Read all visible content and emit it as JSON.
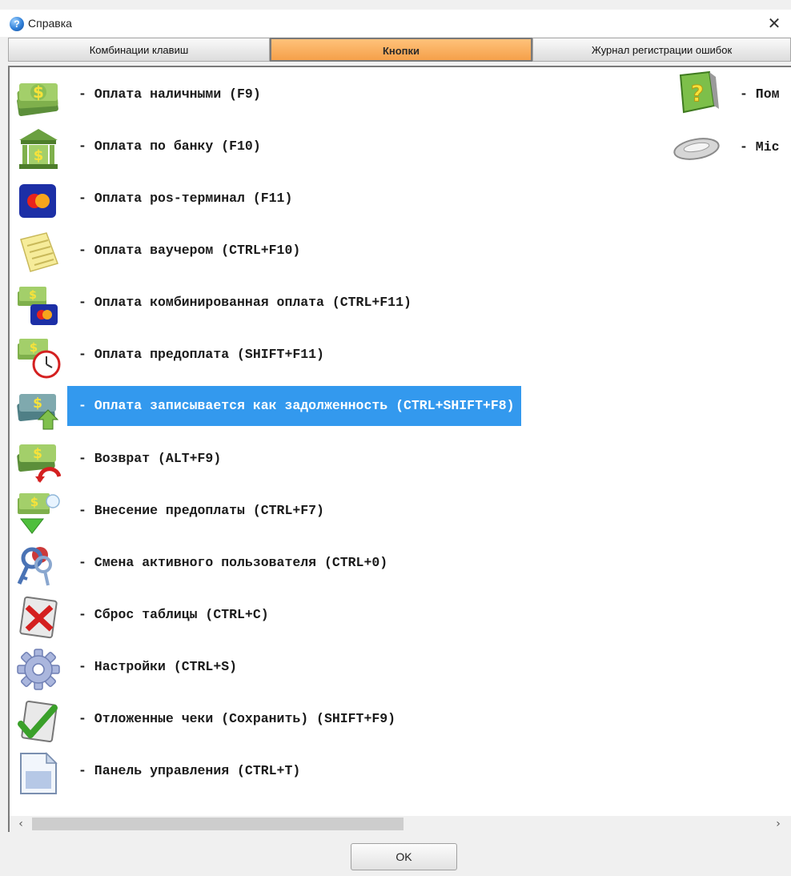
{
  "window": {
    "title": "Справка",
    "close_glyph": "✕"
  },
  "tabs": [
    {
      "label": "Комбинации клавиш",
      "active": false
    },
    {
      "label": "Кнопки",
      "active": true
    },
    {
      "label": "Журнал регистрации ошибок",
      "active": false
    }
  ],
  "items": [
    {
      "icon": "cash-money-icon",
      "label": "- Оплата наличными (F9)"
    },
    {
      "icon": "bank-building-icon",
      "label": "- Оплата по банку (F10)"
    },
    {
      "icon": "credit-card-icon",
      "label": "- Оплата pos-терминал (F11)"
    },
    {
      "icon": "voucher-notepad-icon",
      "label": "- Оплата ваучером (CTRL+F10)"
    },
    {
      "icon": "combined-payment-icon",
      "label": "- Оплата комбинированная оплата (CTRL+F11)"
    },
    {
      "icon": "prepayment-clock-icon",
      "label": "- Оплата предоплата (SHIFT+F11)"
    },
    {
      "icon": "debt-money-icon",
      "label": "- Оплата записывается как задолженность (CTRL+SHIFT+F8)",
      "selected": true
    },
    {
      "icon": "refund-money-icon",
      "label": "- Возврат (ALT+F9)"
    },
    {
      "icon": "deposit-prepayment-icon",
      "label": "- Внесение предоплаты (CTRL+F7)"
    },
    {
      "icon": "user-keys-icon",
      "label": "- Смена активного пользователя (CTRL+0)"
    },
    {
      "icon": "reset-table-icon",
      "label": "- Сброс таблицы (CTRL+C)"
    },
    {
      "icon": "settings-gear-icon",
      "label": "- Настройки (CTRL+S)"
    },
    {
      "icon": "deferred-receipt-icon",
      "label": "- Отложенные чеки (Сохранить) (SHIFT+F9)"
    },
    {
      "icon": "control-panel-icon",
      "label": "- Панель управления (CTRL+T)"
    }
  ],
  "items_col2": [
    {
      "icon": "help-book-icon",
      "label": "- Пом"
    },
    {
      "icon": "scanner-device-icon",
      "label": "- Mic"
    }
  ],
  "footer": {
    "ok_label": "OK"
  },
  "scrollbar": {
    "left_glyph": "‹",
    "right_glyph": "›"
  },
  "colors": {
    "selection": "#3399ee",
    "active_tab": "#f5a04a"
  }
}
